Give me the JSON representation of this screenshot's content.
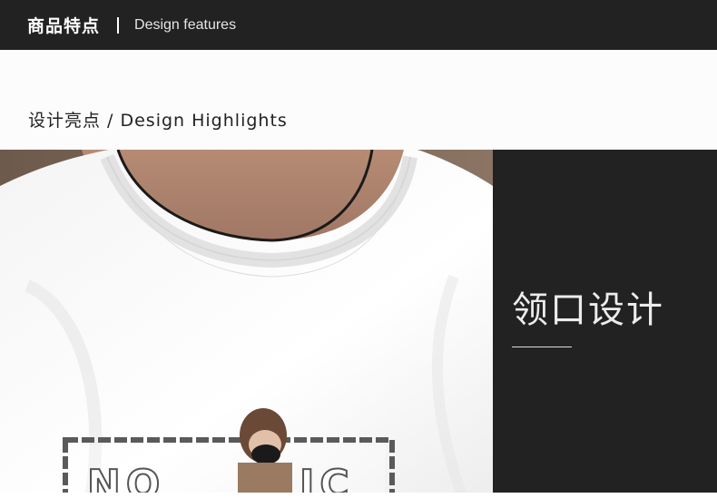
{
  "header": {
    "title_cn": "商品特点",
    "separator": "|",
    "title_en": "Design features"
  },
  "section": {
    "heading": "设计亮点 / Design Highlights"
  },
  "feature": {
    "title": "领口设计",
    "photo_alt": "Close-up of a white crew-neck T-shirt collar with a black cord necklace and a printed graphic"
  },
  "colors": {
    "header_bg": "#222222",
    "panel_bg": "#222222",
    "subhead_bg": "#fcfcfd",
    "text_light": "#ececec",
    "text_dark": "#222222"
  }
}
